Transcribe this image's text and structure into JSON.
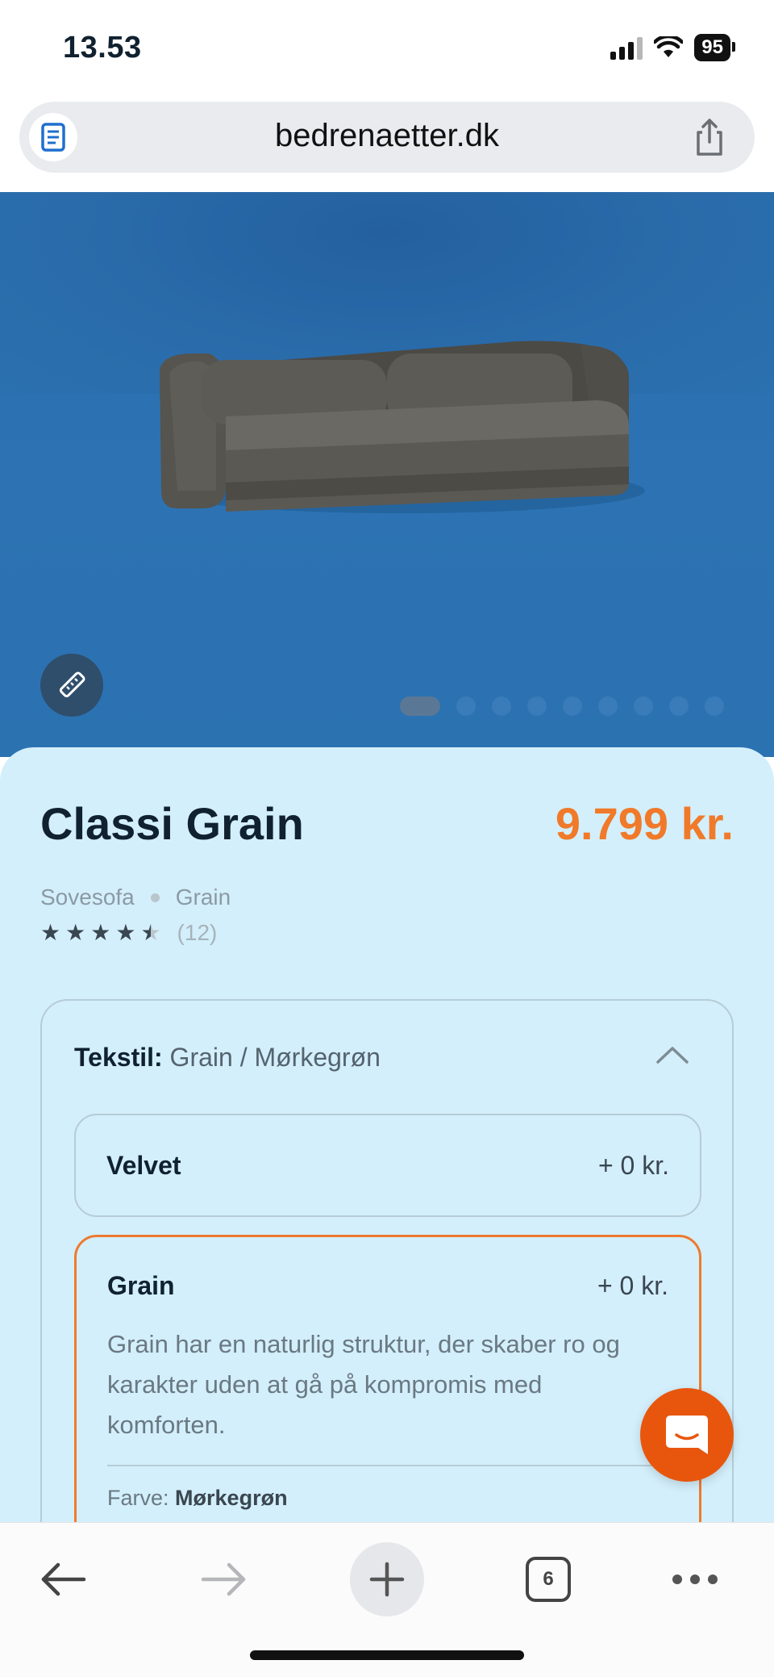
{
  "status": {
    "time": "13.53",
    "battery": "95"
  },
  "browser": {
    "url": "bedrenaetter.dk",
    "open_tabs": "6"
  },
  "gallery": {
    "image_count": 9,
    "active_index": 0
  },
  "product": {
    "name": "Classi Grain",
    "price": "9.799 kr.",
    "category": "Sovesofa",
    "variant": "Grain",
    "rating": 4.5,
    "review_count": "(12)"
  },
  "textile": {
    "label": "Tekstil:",
    "value": "Grain / Mørkegrøn",
    "options": [
      {
        "name": "Velvet",
        "price": "+ 0 kr."
      },
      {
        "name": "Grain",
        "price": "+ 0 kr.",
        "description": "Grain har en naturlig struktur, der skaber ro og karakter uden at gå på kompromis med komforten.",
        "color_label": "Farve:",
        "color_value": "Mørkegrøn"
      }
    ]
  },
  "colors": {
    "accent": "#ee7a2f",
    "price": "#f07a2a",
    "card_bg": "#d3effb",
    "hero_bg": "#2b72b1",
    "chat_button": "#e8560e"
  },
  "icons": {
    "reader": "reader-icon",
    "share": "share-icon",
    "measure": "ruler-icon",
    "collapse": "chevron-up-icon",
    "chat": "chat-icon",
    "back": "arrow-left-icon",
    "forward": "arrow-right-icon",
    "new_tab": "plus-icon",
    "more": "more-icon"
  }
}
